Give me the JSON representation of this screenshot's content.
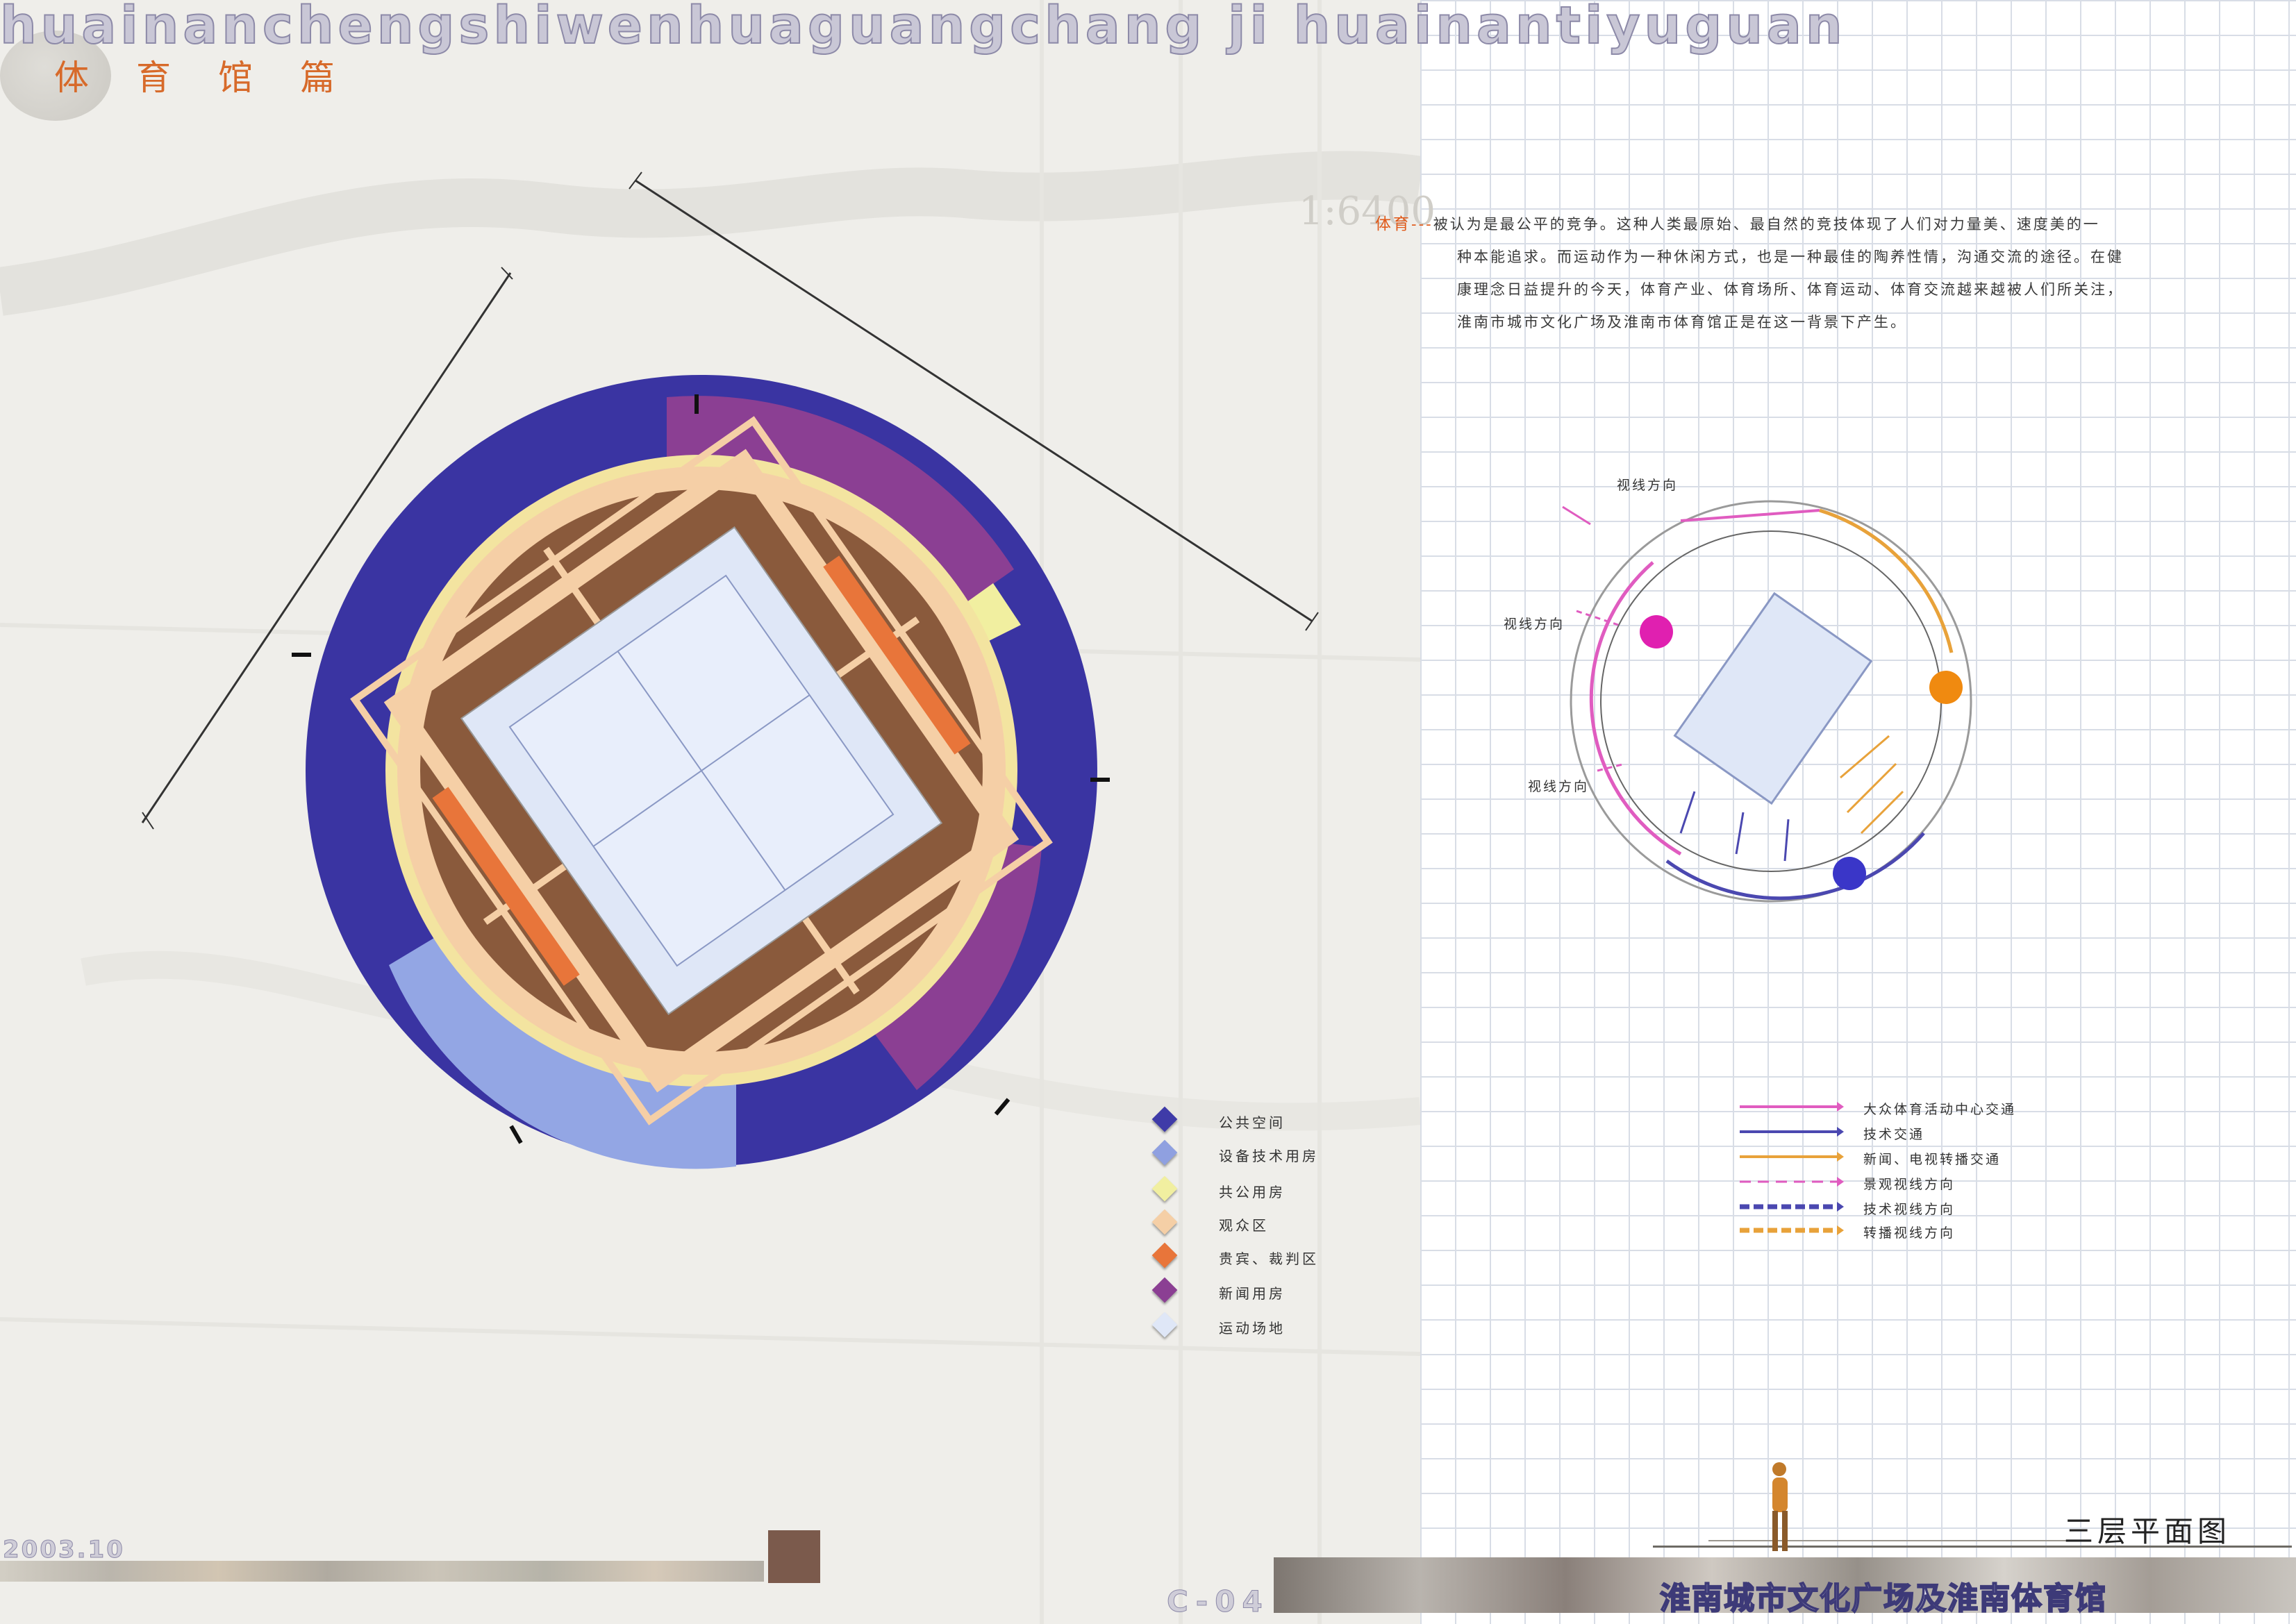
{
  "header": {
    "banner_text": "huainanchengshiwenhuaguangchang ji huainantiyuguan",
    "section_title": "体育馆篇",
    "scale": "1:6400"
  },
  "intro": {
    "keyword": "体育",
    "dash": "---",
    "line1": "被认为是最公平的竞争。这种人类最原始、最自然的竞技体现了人们对力量美、速度美的一",
    "line2": "种本能追求。而运动作为一种休闲方式，也是一种最佳的陶养性情，沟通交流的途径。在健",
    "line3": "康理念日益提升的今天，体育产业、体育场所、体育运动、体育交流越来越被人们所关注，",
    "line4": "淮南市城市文化广场及淮南市体育馆正是在这一背景下产生。"
  },
  "sightline_labels": [
    "视线方向",
    "视线方向",
    "视线方向"
  ],
  "legend_zones": [
    {
      "label": "公共空间",
      "color": "#3f3ba8"
    },
    {
      "label": "设备技术用房",
      "color": "#8fa0e0"
    },
    {
      "label": "共公用房",
      "color": "#f1efa0"
    },
    {
      "label": "观众区",
      "color": "#f5cfa6"
    },
    {
      "label": "贵宾、裁判区",
      "color": "#e8753a"
    },
    {
      "label": "新闻用房",
      "color": "#8b3f93"
    },
    {
      "label": "运动场地",
      "color": "#dfe7f7"
    }
  ],
  "legend_circulation": [
    {
      "label": "大众体育活动中心交通",
      "color": "#e05cc0",
      "style": "solid"
    },
    {
      "label": "技术交通",
      "color": "#4b48b0",
      "style": "solid"
    },
    {
      "label": "新闻、电视转播交通",
      "color": "#e8a23a",
      "style": "solid"
    },
    {
      "label": "景观视线方向",
      "color": "#e05cc0",
      "style": "dashed"
    },
    {
      "label": "技术视线方向",
      "color": "#4b48b0",
      "style": "dashed"
    },
    {
      "label": "转播视线方向",
      "color": "#e8a23a",
      "style": "dashed"
    }
  ],
  "footer": {
    "date": "2003.10",
    "page_code": "C-04",
    "project_title": "淮南城市文化广场及淮南体育馆",
    "plan_label": "三层平面图"
  }
}
